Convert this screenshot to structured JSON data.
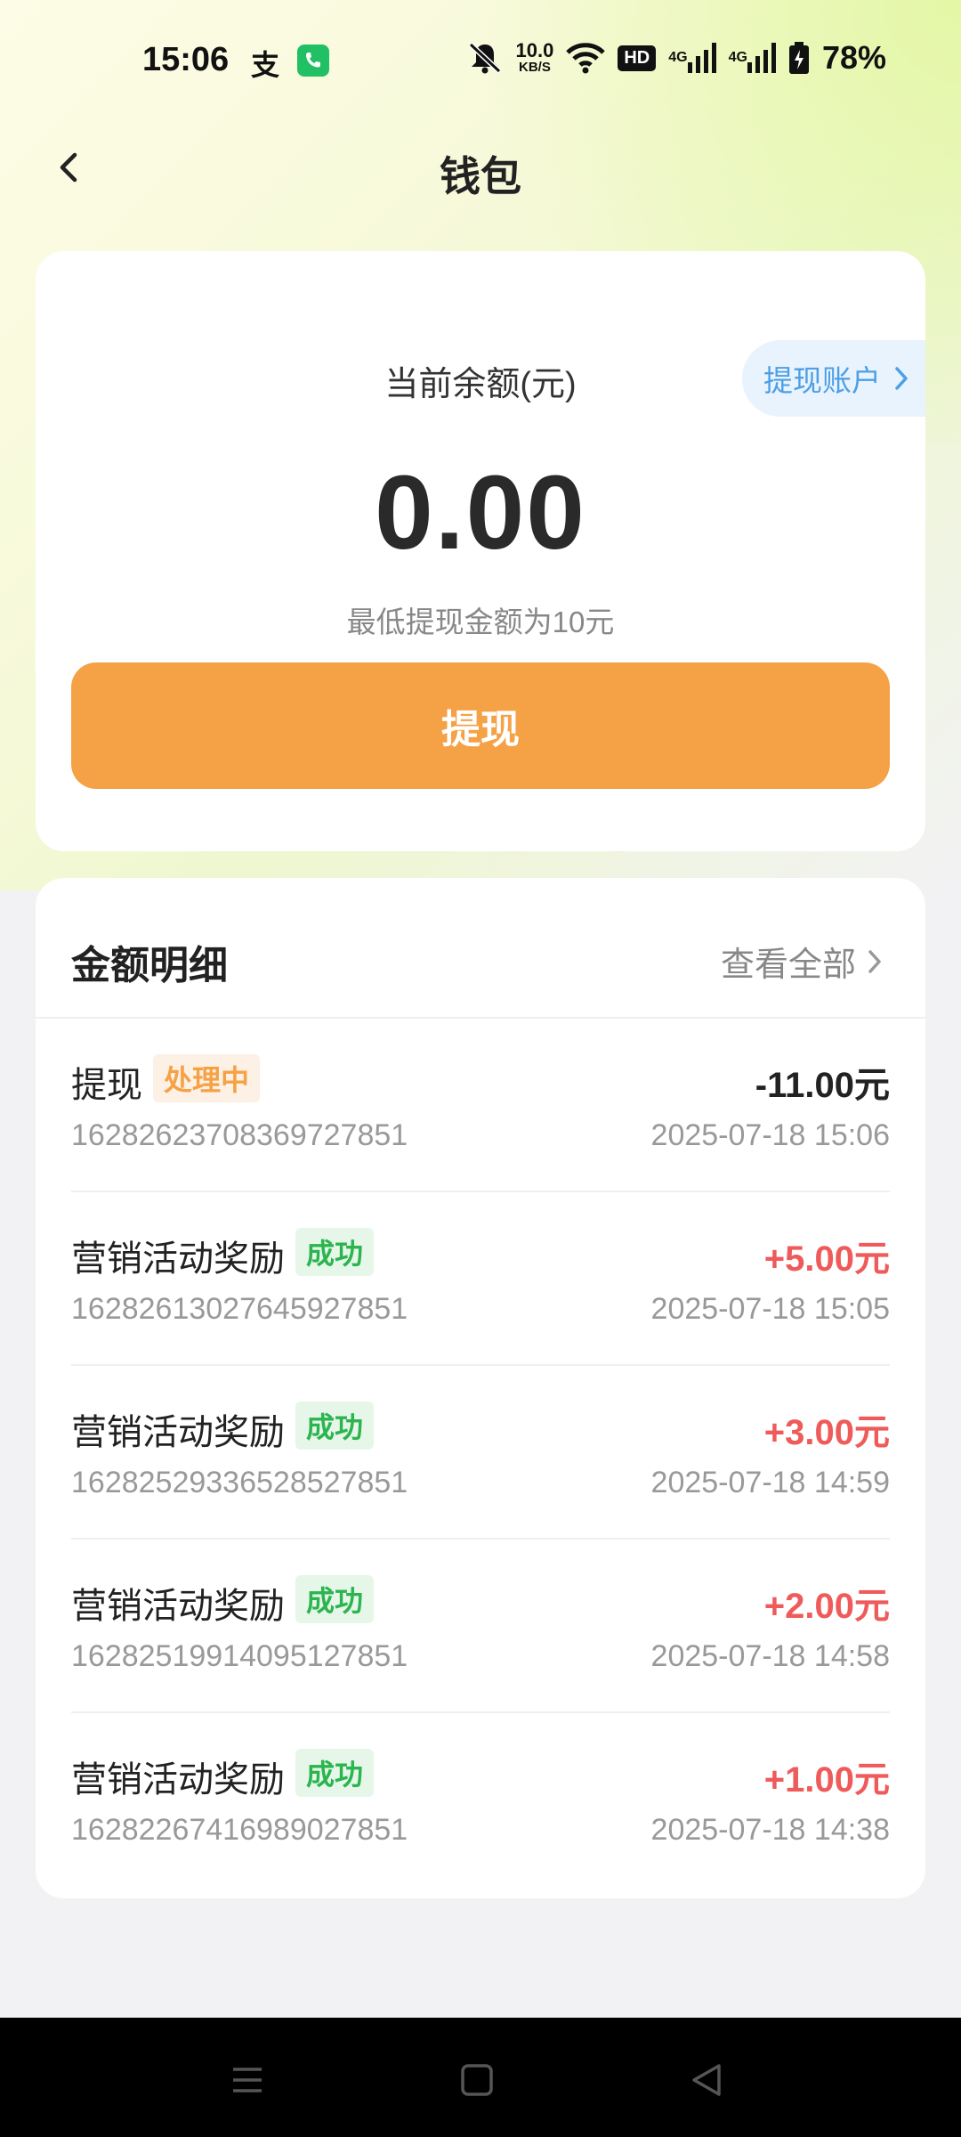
{
  "status_bar": {
    "time": "15:06",
    "alipay_icon": "支",
    "speed_value": "10.0",
    "speed_unit": "KB/S",
    "hd": "HD",
    "net1": "4G",
    "net2": "4G",
    "battery": "78%"
  },
  "header": {
    "title": "钱包"
  },
  "balance": {
    "label": "当前余额(元)",
    "amount": "0.00",
    "min_note": "最低提现金额为10元",
    "withdraw_button": "提现",
    "withdraw_account": "提现账户"
  },
  "details": {
    "title": "金额明细",
    "view_all": "查看全部",
    "transactions": [
      {
        "title": "提现",
        "badge": "处理中",
        "id": "1628262370836972785​1",
        "amount": "-11.00元",
        "time": "2025-07-18 15:06"
      },
      {
        "title": "营销活动奖励",
        "badge": "成功",
        "id": "1628261302764592785​1",
        "amount": "+5.00元",
        "time": "2025-07-18 15:05"
      },
      {
        "title": "营销活动奖励",
        "badge": "成功",
        "id": "1628252933652852785​1",
        "amount": "+3.00元",
        "time": "2025-07-18 14:59"
      },
      {
        "title": "营销活动奖励",
        "badge": "成功",
        "id": "1628251991409512785​1",
        "amount": "+2.00元",
        "time": "2025-07-18 14:58"
      },
      {
        "title": "营销活动奖励",
        "badge": "成功",
        "id": "1628226741698902785​1",
        "amount": "+1.00元",
        "time": "2025-07-18 14:38"
      }
    ]
  },
  "colors": {
    "accent_orange": "#f5a246",
    "positive_red": "#ef5a5a",
    "success_green": "#2cb44f",
    "link_blue": "#4d9fe6"
  },
  "icons": {
    "back": "back-arrow-icon",
    "chevron": "chevron-right-icon",
    "nav_menu": "menu-icon",
    "nav_home": "home-square-icon",
    "nav_back": "back-triangle-icon"
  }
}
